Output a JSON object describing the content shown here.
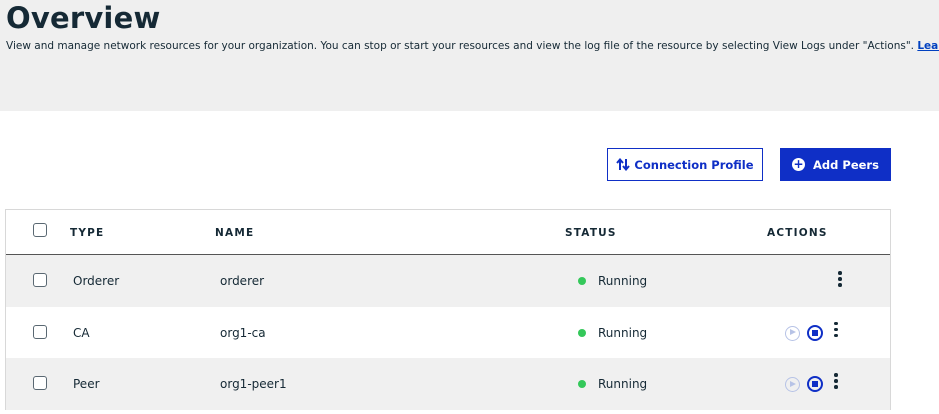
{
  "header": {
    "title": "Overview",
    "description": "View and manage network resources for your organization. You can stop or start your resources and view the log file of the resource by selecting View Logs under \"Actions\".",
    "learn_more": "Learn more"
  },
  "toolbar": {
    "connection_profile_label": "Connection Profile",
    "add_peers_label": "Add Peers"
  },
  "table": {
    "columns": [
      "TYPE",
      "NAME",
      "STATUS",
      "ACTIONS"
    ],
    "rows": [
      {
        "type": "Orderer",
        "name": "orderer",
        "status": "Running",
        "actions": [
          "more"
        ]
      },
      {
        "type": "CA",
        "name": "org1-ca",
        "status": "Running",
        "actions": [
          "play",
          "stop",
          "more"
        ]
      },
      {
        "type": "Peer",
        "name": "org1-peer1",
        "status": "Running",
        "actions": [
          "play",
          "stop",
          "more"
        ]
      }
    ]
  },
  "colors": {
    "primary": "#0f2fc6",
    "status_running": "#34c85a",
    "header_bg": "#efefef"
  },
  "icons": {
    "connection_profile": "sort-arrows-icon",
    "add_peers": "plus-circle-icon",
    "status": "status-dot-icon",
    "play": "play-circle-icon",
    "stop": "stop-circle-icon",
    "more": "overflow-menu-icon"
  }
}
